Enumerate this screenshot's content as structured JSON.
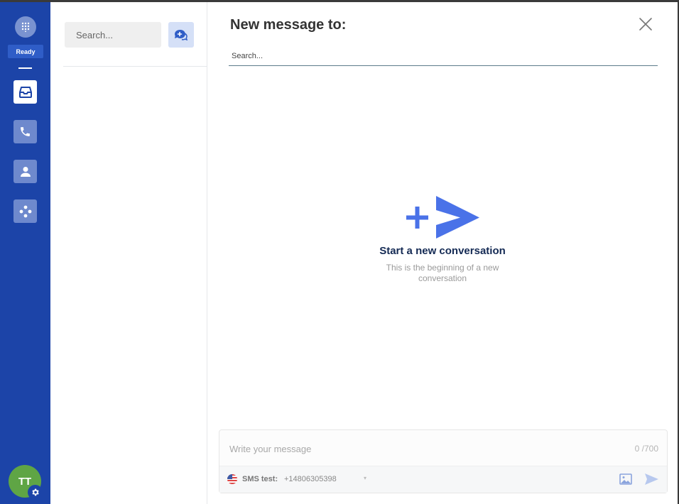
{
  "rail": {
    "status": "Ready",
    "avatar_initials": "TT",
    "nav": [
      {
        "name": "inbox",
        "icon": "inbox-icon",
        "active": true
      },
      {
        "name": "calls",
        "icon": "phone-icon",
        "active": false
      },
      {
        "name": "contacts",
        "icon": "person-icon",
        "active": false
      },
      {
        "name": "integrations",
        "icon": "dots-icon",
        "active": false
      }
    ]
  },
  "list_pane": {
    "search_placeholder": "Search..."
  },
  "main": {
    "title": "New message to:",
    "to_search_placeholder": "Search...",
    "empty_title": "Start a new conversation",
    "empty_subtitle": "This is the beginning of a new conversation"
  },
  "composer": {
    "placeholder": "Write your message",
    "char_count": "0 /700",
    "sender_label": "SMS test:",
    "sender_number": "+14806305398",
    "caret": "▾"
  },
  "colors": {
    "rail": "#1c44a8",
    "accent": "#4a72e8",
    "avatar": "#5fa545",
    "title_text": "#142a54"
  }
}
